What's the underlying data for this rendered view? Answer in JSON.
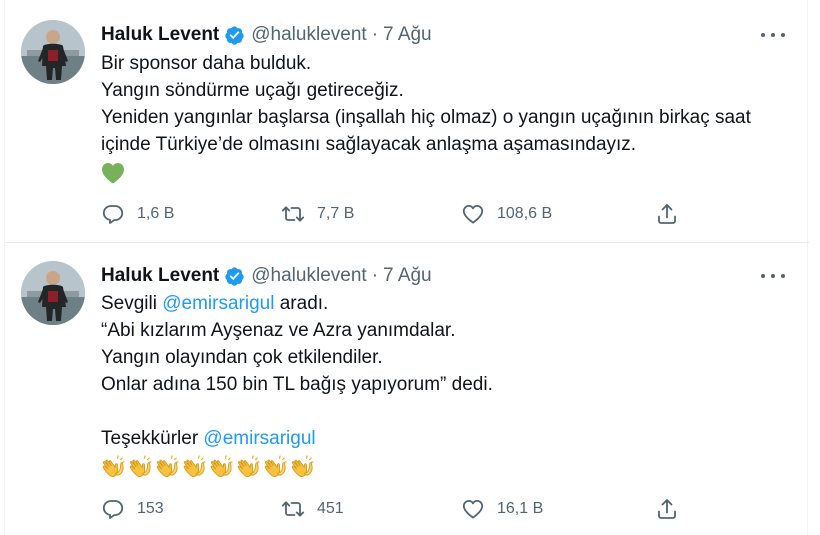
{
  "tweets": [
    {
      "author_name": "Haluk Levent",
      "handle": "@haluklevent",
      "separator": "·",
      "date": "7 Ağu",
      "lines": [
        "Bir sponsor daha bulduk.",
        "Yangın söndürme uçağı getireceğiz.",
        "Yeniden yangınlar başlarsa (inşallah hiç olmaz) o yangın uçağının birkaç saat",
        "içinde Türkiye’de olmasını sağlayacak anlaşma aşamasındayız."
      ],
      "emoji": [
        "green-heart"
      ],
      "replies": "1,6 B",
      "retweets": "7,7 B",
      "likes": "108,6 B"
    },
    {
      "author_name": "Haluk Levent",
      "handle": "@haluklevent",
      "separator": "·",
      "date": "7 Ağu",
      "line1_before": "Sevgili ",
      "line1_mention": "@emirsarigul",
      "line1_after": " aradı.",
      "lines": [
        "“Abi kızlarım Ayşenaz ve Azra yanımdalar.",
        "Yangın olayından çok etkilendiler.",
        "Onlar adına 150 bin TL bağış yapıyorum” dedi."
      ],
      "thanks_text": "Teşekkürler ",
      "thanks_mention": "@emirsarigul",
      "emoji": [
        "clapping-hands",
        "clapping-hands",
        "clapping-hands",
        "clapping-hands",
        "clapping-hands",
        "clapping-hands",
        "clapping-hands",
        "clapping-hands"
      ],
      "replies": "153",
      "retweets": "451",
      "likes": "16,1 B"
    }
  ],
  "colors": {
    "text": "#0f1419",
    "secondary": "#536471",
    "link": "#1d9bf0",
    "verified": "#1d9bf0",
    "divider": "#e6ecf0"
  }
}
